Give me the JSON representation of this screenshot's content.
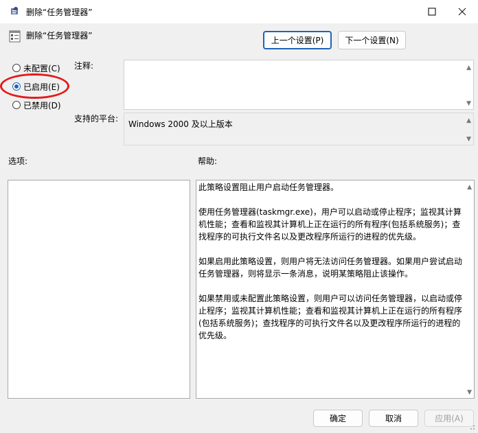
{
  "window": {
    "title": "删除“任务管理器”",
    "icon": "group-policy-icon",
    "controls": {
      "maximize": "maximize-icon",
      "close": "close-icon"
    }
  },
  "header": {
    "policy_title": "删除“任务管理器”",
    "prev_button": "上一个设置(P)",
    "next_button": "下一个设置(N)"
  },
  "state": {
    "options": [
      {
        "label": "未配置(C)",
        "selected": false
      },
      {
        "label": "已启用(E)",
        "selected": true
      },
      {
        "label": "已禁用(D)",
        "selected": false
      }
    ]
  },
  "comment": {
    "label": "注释:",
    "value": ""
  },
  "platform": {
    "label": "支持的平台:",
    "value": "Windows 2000 及以上版本"
  },
  "options_panel": {
    "label": "选项:"
  },
  "help": {
    "label": "帮助:",
    "paragraphs": [
      "此策略设置阻止用户启动任务管理器。",
      "使用任务管理器(taskmgr.exe)，用户可以启动或停止程序；监视其计算机性能；查看和监视其计算机上正在运行的所有程序(包括系统服务)；查找程序的可执行文件名以及更改程序所运行的进程的优先级。",
      "如果启用此策略设置，则用户将无法访问任务管理器。如果用户尝试启动任务管理器，则将显示一条消息，说明某策略阻止该操作。",
      "如果禁用或未配置此策略设置，则用户可以访问任务管理器，以启动或停止程序；监视其计算机性能；查看和监视其计算机上正在运行的所有程序(包括系统服务)；查找程序的可执行文件名以及更改程序所运行的进程的优先级。"
    ]
  },
  "footer": {
    "ok": "确定",
    "cancel": "取消",
    "apply": "应用(A)"
  },
  "annotation": {
    "color": "#e41b1b"
  },
  "accent_color": "#1f63b6"
}
